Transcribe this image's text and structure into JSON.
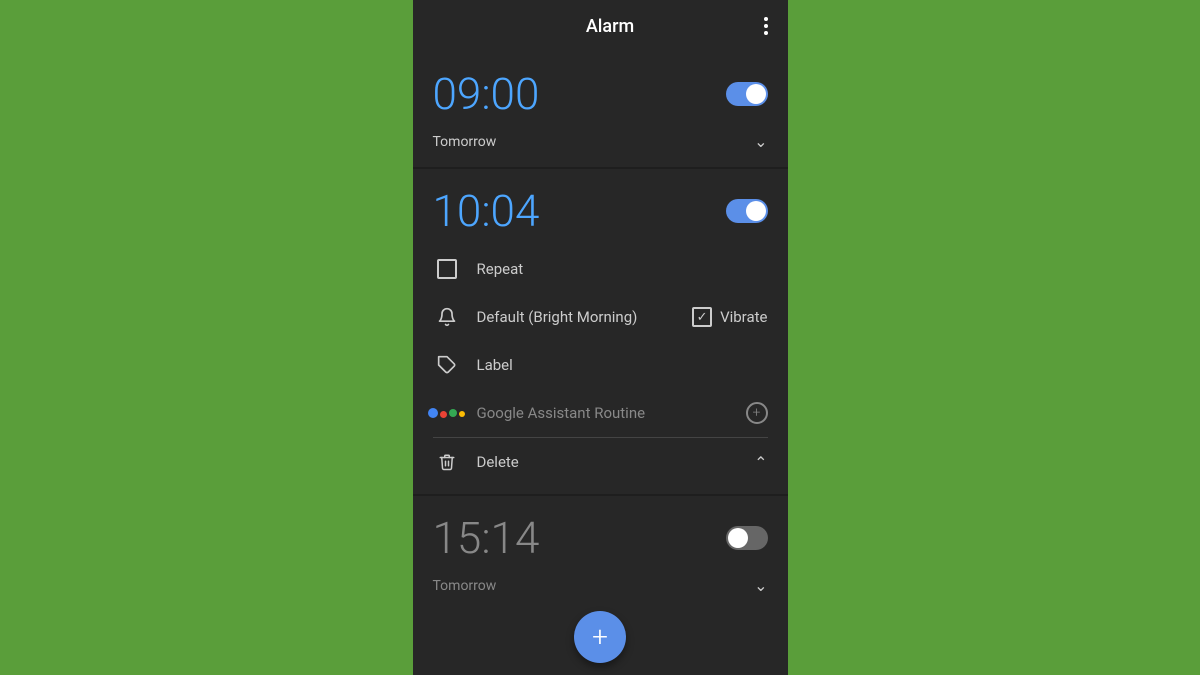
{
  "header": {
    "title": "Alarm",
    "menu_icon": "three-dots-vertical"
  },
  "alarms": [
    {
      "id": "alarm-1",
      "time": "09:00",
      "enabled": true,
      "subtitle": "Tomorrow",
      "expanded": false
    },
    {
      "id": "alarm-2",
      "time": "10:04",
      "enabled": true,
      "subtitle": null,
      "expanded": true,
      "details": {
        "repeat_label": "Repeat",
        "repeat_checked": false,
        "ringtone_label": "Default (Bright Morning)",
        "vibrate_label": "Vibrate",
        "vibrate_checked": true,
        "label_label": "Label",
        "ga_label": "Google Assistant Routine",
        "delete_label": "Delete"
      }
    },
    {
      "id": "alarm-3",
      "time": "15:14",
      "enabled": false,
      "subtitle": "Tomorrow",
      "expanded": false
    }
  ],
  "fab": {
    "label": "+"
  }
}
